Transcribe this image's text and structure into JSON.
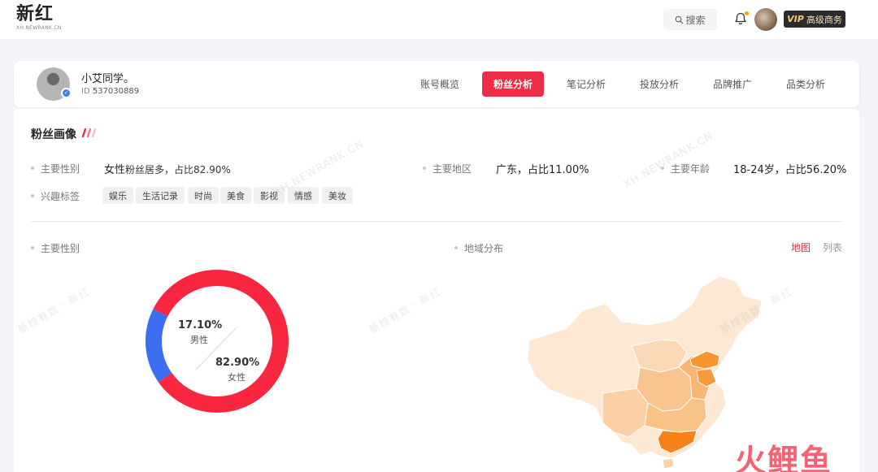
{
  "header": {
    "logo_main": "新红",
    "logo_sub": "XH.NEWRANK.CN",
    "search_label": "搜索",
    "vip_tag": "VIP",
    "vip_label": "高级商务"
  },
  "profile": {
    "name": "小艾同学。",
    "id_prefix": "ID",
    "id_value": "537030889"
  },
  "tabs": [
    {
      "label": "账号概览"
    },
    {
      "label": "粉丝分析",
      "active": true
    },
    {
      "label": "笔记分析"
    },
    {
      "label": "投放分析"
    },
    {
      "label": "品牌推广"
    },
    {
      "label": "品类分析"
    }
  ],
  "fan_profile": {
    "title": "粉丝画像",
    "gender_label": "主要性别",
    "gender_main": "女性",
    "gender_detail": "粉丝居多，占比82.90%",
    "region_label": "主要地区",
    "region_value": "广东，占比11.00%",
    "age_label": "主要年龄",
    "age_value": "18-24岁，占比56.20%",
    "interest_label": "兴趣标签",
    "interest_tags": [
      "娱乐",
      "生活记录",
      "时尚",
      "美食",
      "影视",
      "情感",
      "美妆"
    ]
  },
  "gender_chart": {
    "label": "主要性别",
    "chart_data": {
      "type": "pie",
      "slices": [
        {
          "name": "男性",
          "value": 17.1,
          "color": "#3d6ef0"
        },
        {
          "name": "女性",
          "value": 82.9,
          "color": "#f8263f"
        }
      ]
    },
    "male_pct": "17.10%",
    "male_label": "男性",
    "female_pct": "82.90%",
    "female_label": "女性"
  },
  "region_chart": {
    "label": "地域分布",
    "toggle_map": "地图",
    "toggle_list": "列表"
  },
  "watermarks": {
    "site": "XH.NEWRANK.CN",
    "brand": "新榜有数 · 新红"
  },
  "corner_mark": "火鲤鱼",
  "colors": {
    "accent": "#f02d46",
    "male": "#3d6ef0",
    "female": "#f8263f",
    "map_light": "#fce7d2",
    "map_dark": "#f7881f"
  }
}
